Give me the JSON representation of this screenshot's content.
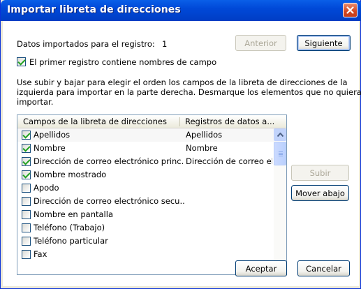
{
  "window": {
    "title": "Importar libreta de direcciones"
  },
  "record": {
    "label": "Datos importados para el registro:",
    "number": "1"
  },
  "buttons": {
    "previous": "Anterior",
    "next": "Siguiente",
    "up": "Subir",
    "down": "Mover abajo",
    "ok": "Aceptar",
    "cancel": "Cancelar"
  },
  "first_record_checkbox": {
    "label": "El primer registro contiene nombres de campo",
    "checked": true
  },
  "instructions": [
    "Use subir y bajar para elegir el orden los campos de la libreta de direcciones de la",
    "izquierda para importar en la parte derecha. Desmarque los elementos que no quiera",
    "importar."
  ],
  "table": {
    "columns": [
      "Campos de la libreta de direcciones",
      "Registros de datos a..."
    ],
    "rows": [
      {
        "field": "Apellidos",
        "data": "Apellidos",
        "checked": true,
        "selected": true
      },
      {
        "field": "Nombre",
        "data": "Nombre",
        "checked": true
      },
      {
        "field": "Dirección de correo electrónico princ...",
        "data": "Dirección de correo el",
        "checked": true
      },
      {
        "field": "Nombre mostrado",
        "data": "",
        "checked": true
      },
      {
        "field": "Apodo",
        "data": "",
        "checked": false
      },
      {
        "field": "Dirección de correo electrónico secu...",
        "data": "",
        "checked": false
      },
      {
        "field": "Nombre en pantalla",
        "data": "",
        "checked": false
      },
      {
        "field": "Teléfono (Trabajo)",
        "data": "",
        "checked": false
      },
      {
        "field": "Teléfono particular",
        "data": "",
        "checked": false
      },
      {
        "field": "Fax",
        "data": "",
        "checked": false
      }
    ]
  },
  "colors": {
    "titlebar": "#0054e3",
    "window_bg": "#ffffff",
    "button_border": "#003c74",
    "check": "#21a121"
  },
  "icons": [
    "close-icon",
    "arrow-up-icon",
    "arrow-down-icon"
  ]
}
